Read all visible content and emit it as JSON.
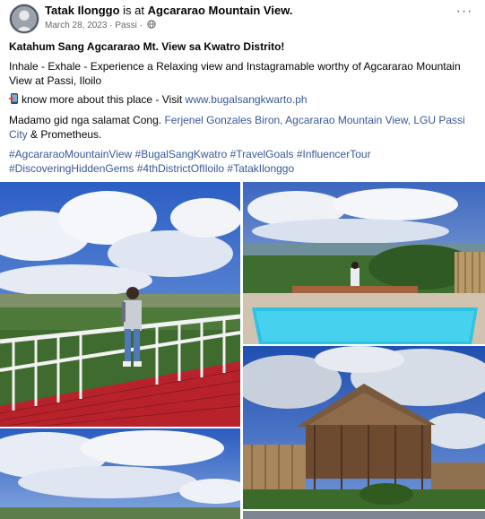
{
  "header": {
    "author": "Tatak Ilonggo",
    "connector": "is at",
    "place": "Agcararao Mountain View.",
    "date": "March 28, 2023",
    "location": "Passi",
    "more_label": "···",
    "icons": {
      "audience": "globe-icon",
      "more": "more-options-icon",
      "avatar": "avatar"
    }
  },
  "post": {
    "title": "Katahum Sang Agcararao Mt. View sa Kwatro Distrito!",
    "paragraph1": "Inhale - Exhale - Experience a Relaxing view and Instagramable worthy of Agcararao Mountain View at Passi, Iloilo",
    "visit_prefix": "know more about this place - Visit ",
    "visit_link": "www.bugalsangkwarto.ph",
    "thanks_prefix": "Madamo gid nga salamat Cong. ",
    "thanks_links": "Ferjenel Gonzales Biron, Agcararao Mountain View, LGU Passi City",
    "thanks_suffix": " & Prometheus.",
    "hashtags_line1": "#AgcararaoMountainView #BugalSangKwatro #TravelGoals #InfluencerTour",
    "hashtags_line2": "#DiscoveringHiddenGems #4thDistrictOfIloilo #TatakIlonggo"
  },
  "photos": [
    {
      "name": "photo-deck-woman"
    },
    {
      "name": "photo-pool-view"
    },
    {
      "name": "photo-sky-landscape"
    },
    {
      "name": "photo-nipa-hut"
    },
    {
      "name": "photo-next"
    }
  ],
  "colors": {
    "link": "#385898",
    "text": "#050505",
    "meta": "#65676b",
    "deck": "#b8232b"
  }
}
